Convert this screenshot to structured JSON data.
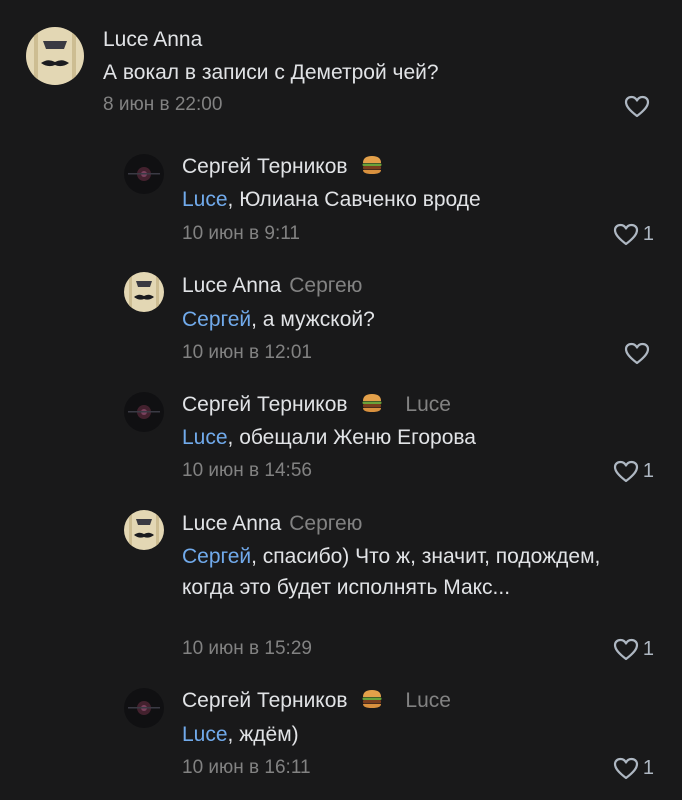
{
  "comments": [
    {
      "author": "Luce Anna",
      "reply_to": "",
      "text": "А вокал в записи с Деметрой чей?",
      "mention": "",
      "date": "8 июн в 22:00",
      "likes": ""
    },
    {
      "author": "Сергей Терников",
      "reply_to": "",
      "mention": "Luce",
      "text": ", Юлиана Савченко вроде",
      "date": "10 июн в 9:11",
      "likes": "1"
    },
    {
      "author": "Luce Anna",
      "reply_to": "Сергею",
      "mention": "Сергей",
      "text": ", а мужской?",
      "date": "10 июн в 12:01",
      "likes": ""
    },
    {
      "author": "Сергей Терников",
      "reply_to": "Luce",
      "mention": "Luce",
      "text": ", обещали Женю Егорова",
      "date": "10 июн в 14:56",
      "likes": "1"
    },
    {
      "author": "Luce Anna",
      "reply_to": "Сергею",
      "mention": "Сергей",
      "text": ", спасибо) Что ж, значит, подождем, когда это будет исполнять Макс...",
      "date": "10 июн в 15:29",
      "likes": "1"
    },
    {
      "author": "Сергей Терников",
      "reply_to": "Luce",
      "mention": "Luce",
      "text": ", ждём)",
      "date": "10 июн в 16:11",
      "likes": "1"
    }
  ],
  "icons": {
    "like": "heart-outline-icon",
    "badge": "hamburger-emoji"
  },
  "colors": {
    "background": "#19191a",
    "mention": "#71aaeb",
    "secondary": "#828282"
  }
}
